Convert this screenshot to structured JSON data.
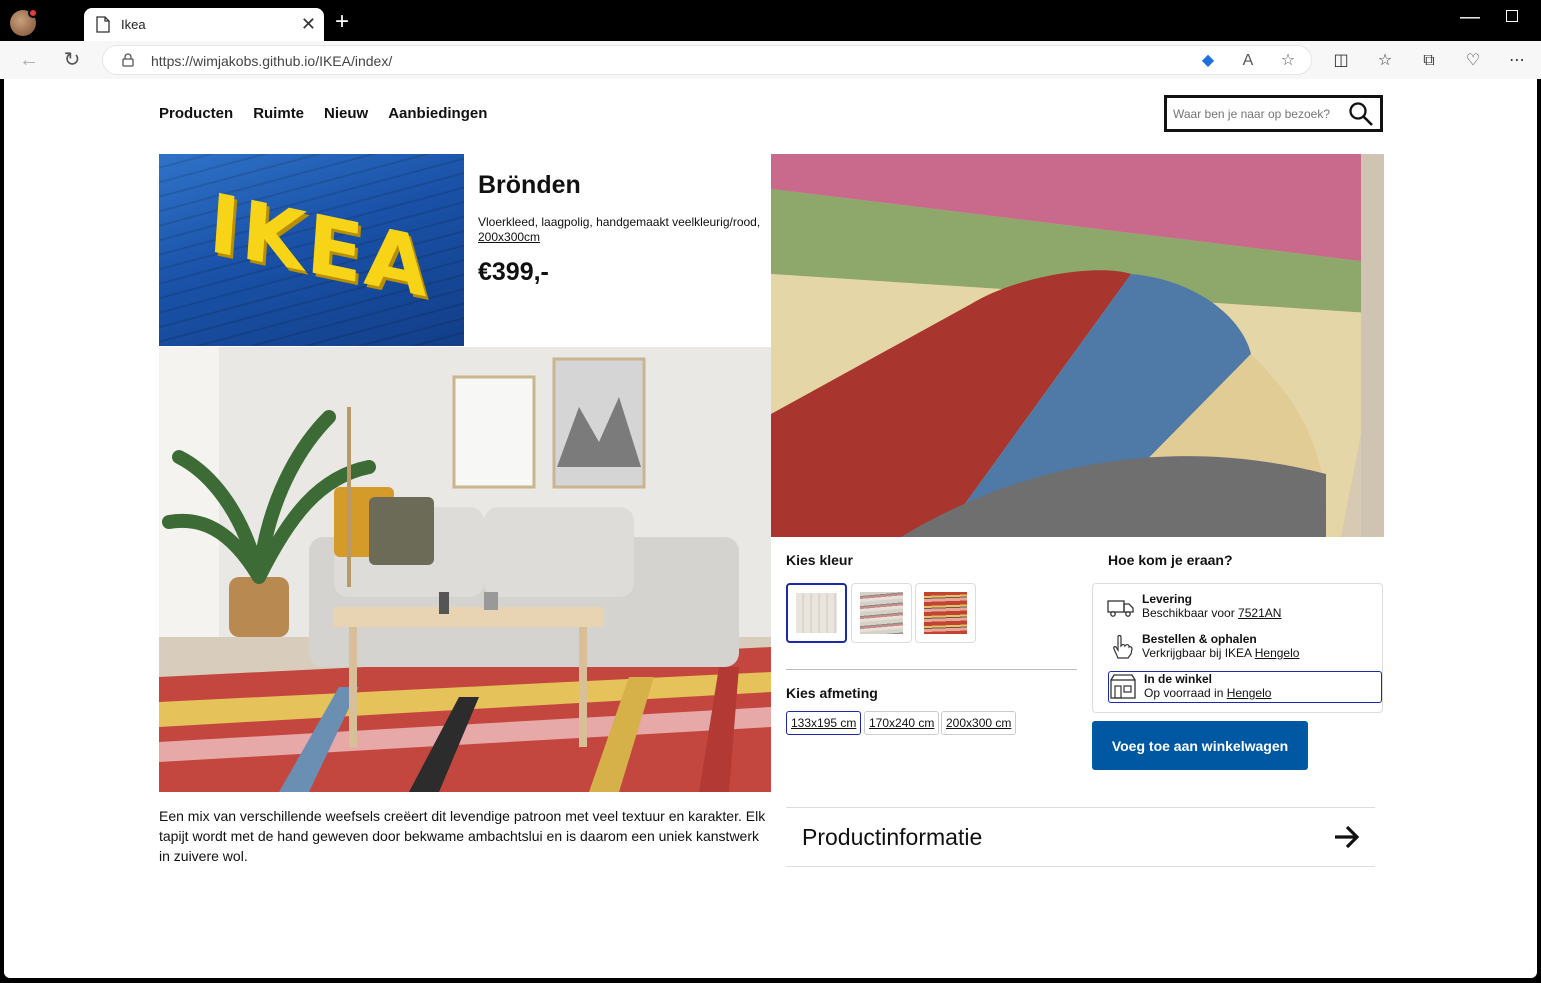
{
  "browser": {
    "tab_title": "Ikea",
    "url": "https://wimjakobs.github.io/IKEA/index/"
  },
  "nav": {
    "items": [
      "Producten",
      "Ruimte",
      "Nieuw",
      "Aanbiedingen"
    ]
  },
  "search": {
    "placeholder": "Waar ben je naar op bezoek?"
  },
  "logo_image": {
    "sign_text": "IKEA"
  },
  "product": {
    "name": "Brönden",
    "description": "Vloerkleed, laagpolig, handgemaakt veelkleurig/rood,",
    "size_link": "200x300cm",
    "price": "€399,-"
  },
  "color_picker": {
    "title": "Kies kleur",
    "selected_index": 0
  },
  "size_picker": {
    "title": "Kies afmeting",
    "options": [
      "133x195 cm",
      "170x240 cm",
      "200x300 cm"
    ],
    "selected_index": 0
  },
  "delivery": {
    "title": "Hoe kom je eraan?",
    "options": [
      {
        "title": "Levering",
        "prefix": "Beschikbaar voor ",
        "link": "7521AN",
        "icon": "truck-icon"
      },
      {
        "title": "Bestellen & ophalen",
        "prefix": "Verkrijgbaar bij IKEA ",
        "link": "Hengelo",
        "icon": "hand-pointer-icon"
      },
      {
        "title": "In de winkel",
        "prefix": "Op voorraad in ",
        "link": "Hengelo",
        "icon": "store-icon"
      }
    ],
    "selected_index": 2
  },
  "cart": {
    "button_label": "Voeg toe aan winkelwagen",
    "color": "#0058a3"
  },
  "product_info": {
    "label": "Productinformatie"
  },
  "description": "Een mix van verschillende weefsels creëert dit levendige patroon met veel textuur en karakter. Elk tapijt wordt met de hand geweven door bekwame ambachtslui en is daarom een uniek kanstwerk in zuivere wol."
}
